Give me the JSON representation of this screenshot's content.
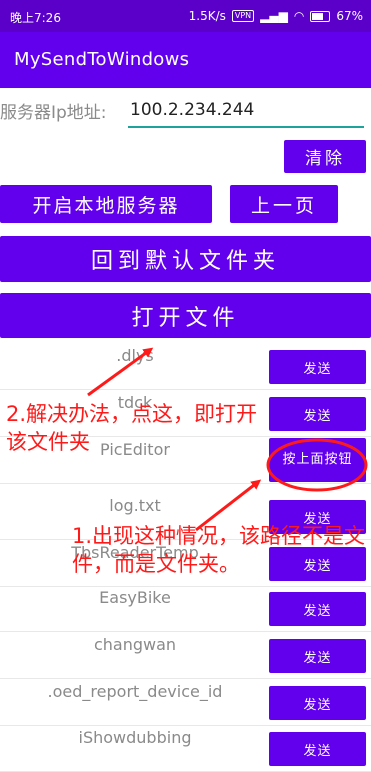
{
  "status_bar": {
    "time": "晚上7:26",
    "speed": "1.5K/s",
    "vpn": "VPN",
    "battery": "67%"
  },
  "app_bar": {
    "title": "MySendToWindows"
  },
  "server": {
    "label": "服务器Ip地址:",
    "value": "100.2.234.244"
  },
  "buttons": {
    "clear": "清除",
    "start_server": "开启本地服务器",
    "prev_page": "上一页",
    "default_folder": "回到默认文件夹",
    "open_file": "打开文件"
  },
  "files": [
    {
      "name": ".dlys",
      "action": "发送"
    },
    {
      "name": "tdck",
      "action": "发送"
    },
    {
      "name": "PicEditor",
      "action": "按上面按钮"
    },
    {
      "name": "log.txt",
      "action": "发送"
    },
    {
      "name": "TbsReaderTemp",
      "action": "发送"
    },
    {
      "name": "EasyBike",
      "action": "发送"
    },
    {
      "name": "changwan",
      "action": "发送"
    },
    {
      "name": ".oed_report_device_id",
      "action": "发送"
    },
    {
      "name": "iShowdubbing",
      "action": "发送"
    }
  ],
  "annotations": {
    "note2": "2.解决办法，点这，即打开该文件夹",
    "note1": "1.出现这种情况，该路径不是文件，而是文件夹。"
  },
  "colors": {
    "primary": "#6200ee",
    "status_bar": "#5a00c8",
    "accent": "#1ea39a",
    "annotation": "#ff1a1a"
  }
}
